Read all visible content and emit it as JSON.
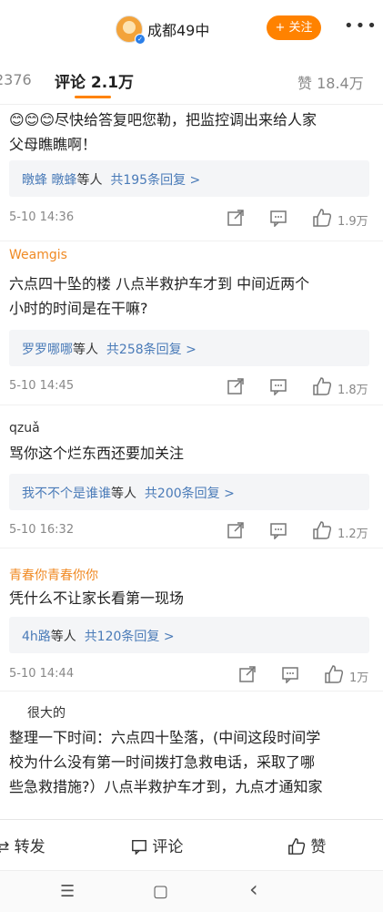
{
  "header": {
    "account_name": "成都49中",
    "follow_label": "+ 关注",
    "more": "•••",
    "avatar_glyph": "A"
  },
  "tabs": {
    "repost_count": "2376",
    "comment_label": "评论",
    "comment_count": "2.1万",
    "like_label": "赞",
    "like_count": "18.4万"
  },
  "comments": [
    {
      "user": "",
      "text_line1": "😊😊😊尽快给答复吧您勒，把监控调出来给人家",
      "text_line2": "父母瞧瞧啊！",
      "reply_names": "暾蜂 暾蜂",
      "reply_etc": "等人",
      "reply_count": "共195条回复 >",
      "time": "5-10 14:36",
      "likes": "1.9万"
    },
    {
      "user": "Weamgis",
      "text_line1": "六点四十坠的楼 八点半救护车才到 中间近两个",
      "text_line2": "小时的时间是在干嘛?",
      "reply_names": "罗罗哪哪",
      "reply_etc": "等人",
      "reply_count": "共258条回复 >",
      "time": "5-10 14:45",
      "likes": "1.8万"
    },
    {
      "user": "qzuǎ",
      "text_line1": "骂你这个烂东西还要加关注",
      "text_line2": "",
      "reply_names": "我不不个是谁谁",
      "reply_etc": "等人",
      "reply_count": "共200条回复 >",
      "time": "5-10 16:32",
      "likes": "1.2万"
    },
    {
      "user": "青春你青春你你",
      "text_line1": "凭什么不让家长看第一现场",
      "text_line2": "",
      "reply_names": "4h路",
      "reply_etc": "等人",
      "reply_count": "共120条回复 >",
      "time": "5-10 14:44",
      "likes": "1万"
    },
    {
      "user": "很大的",
      "text_line1": "整理一下时间：六点四十坠落，(中间这段时间学",
      "text_line2": "校为什么没有第一时间拨打急救电话，采取了哪",
      "text_line3": "些急救措施?）八点半救护车才到，九点才通知家"
    }
  ],
  "bottom_bar": {
    "repost": "转发",
    "comment": "评论",
    "like": "赞"
  },
  "nav": {
    "menu": "☰",
    "home": "▢",
    "back": "‹"
  },
  "colors": {
    "accent": "#ff8200",
    "link": "#4a7bb8"
  }
}
